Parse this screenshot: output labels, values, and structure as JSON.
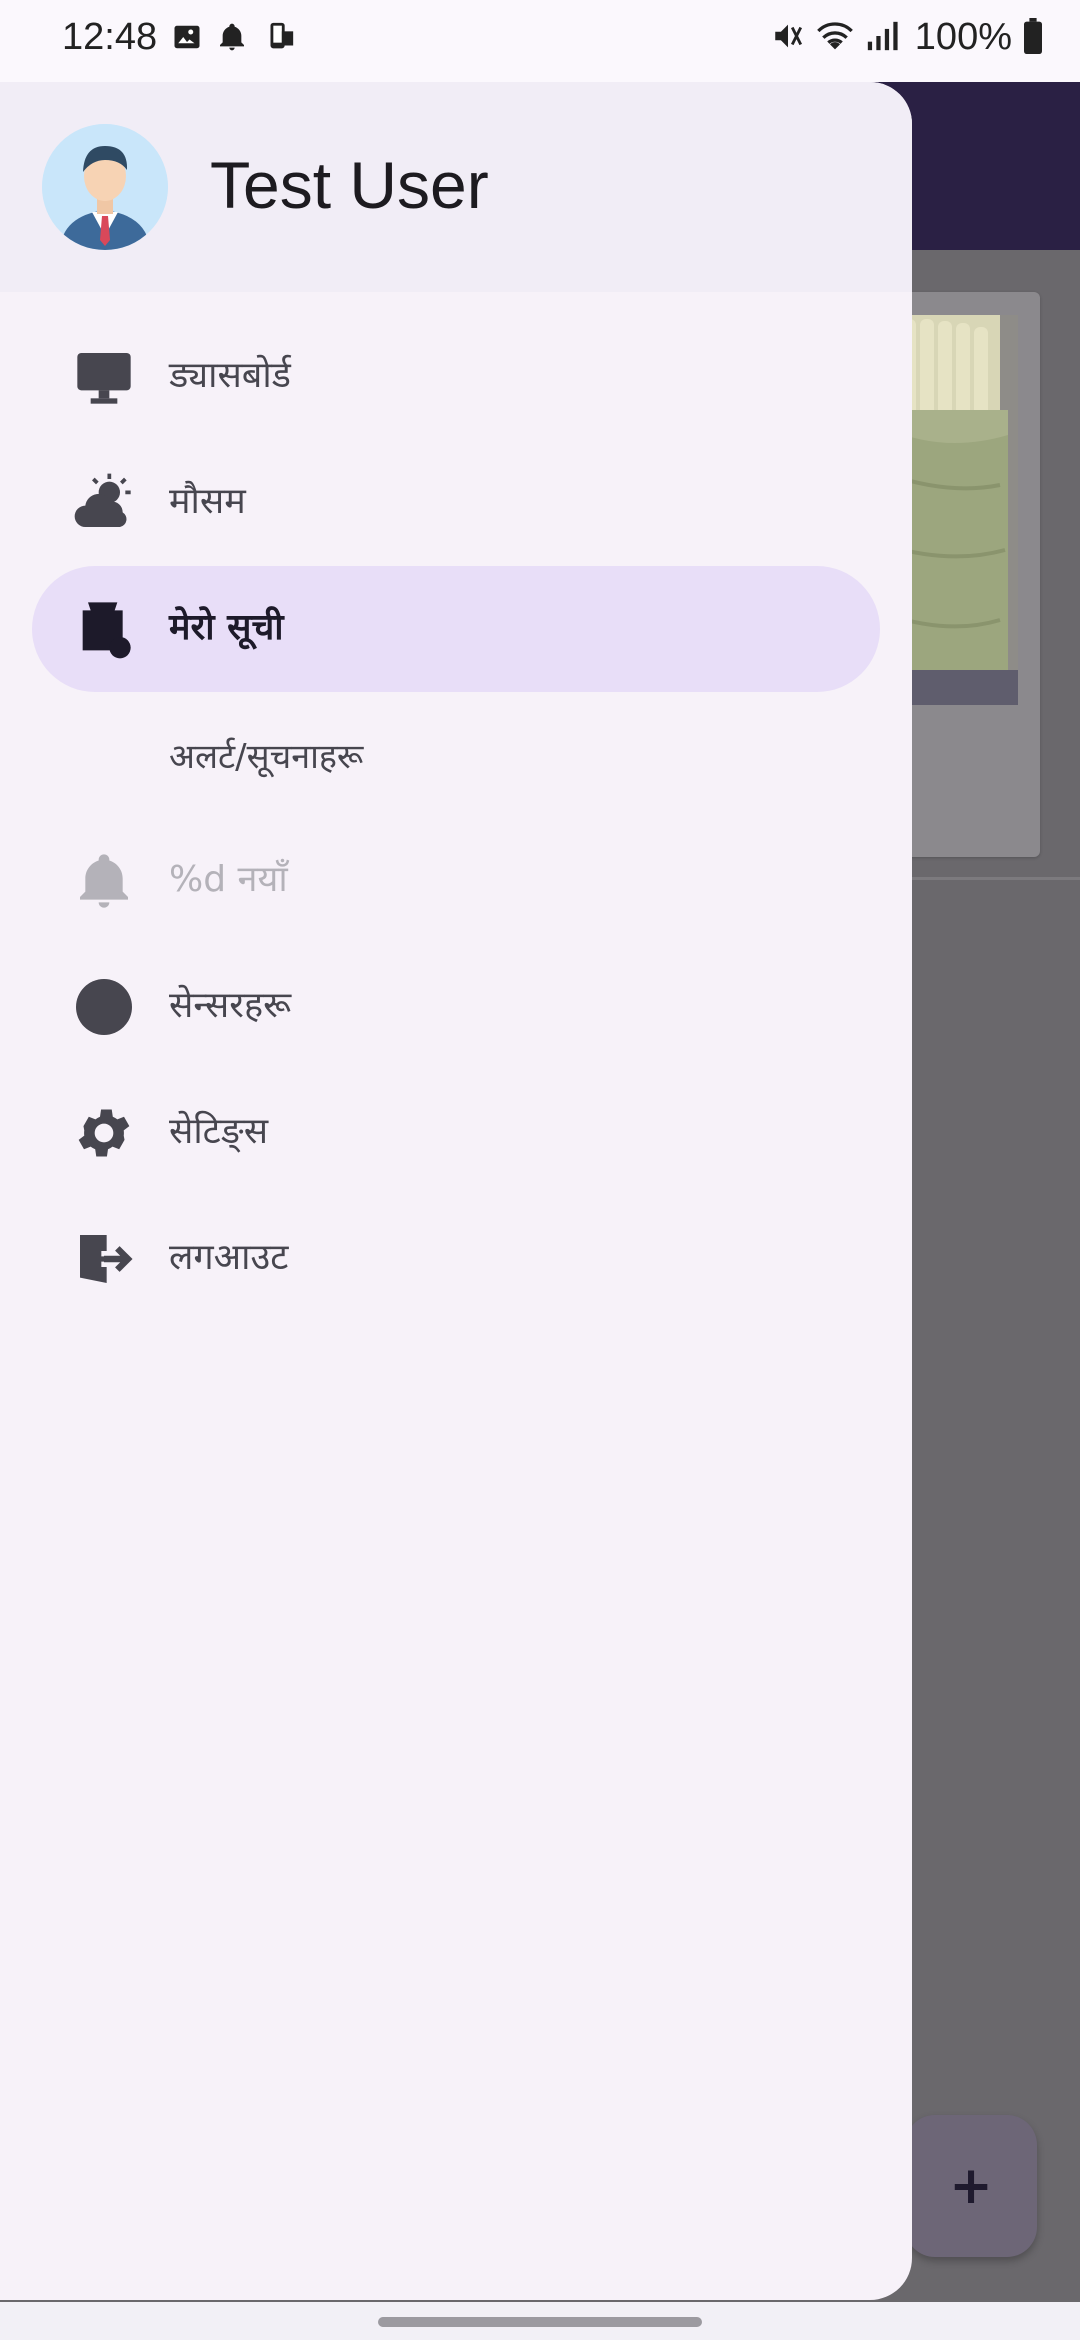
{
  "status_bar": {
    "time": "12:48",
    "battery": "100%",
    "left_icons": [
      "gallery-icon",
      "bell-icon",
      "screen-cast-icon"
    ],
    "right_icons": [
      "mute-icon",
      "wifi-icon",
      "signal-icon",
      "battery-icon"
    ]
  },
  "drawer": {
    "user_name": "Test User",
    "items": [
      {
        "label": "ड्यासबोर्ड",
        "icon": "monitor-icon",
        "selected": false,
        "enabled": true
      },
      {
        "label": "मौसम",
        "icon": "weather-icon",
        "selected": false,
        "enabled": true
      },
      {
        "label": "मेरो सूची",
        "icon": "my-list-icon",
        "selected": true,
        "enabled": true
      },
      {
        "label": "%d नयाँ",
        "icon": "bell-icon",
        "selected": false,
        "enabled": false
      },
      {
        "label": "सेन्सरहरू",
        "icon": "sensor-icon",
        "selected": false,
        "enabled": true
      },
      {
        "label": "सेटिङ्स",
        "icon": "gear-icon",
        "selected": false,
        "enabled": true
      },
      {
        "label": "लगआउट",
        "icon": "logout-icon",
        "selected": false,
        "enabled": true
      }
    ],
    "alerts_subheading": "अलर्ट/सूचनाहरू"
  },
  "background_app": {
    "fab_label": "+"
  },
  "colors": {
    "drawer_bg": "#F7F2F9",
    "selected_bg": "#E8DEF8",
    "icon_color": "#47464F",
    "app_bar": "#2A2044"
  }
}
